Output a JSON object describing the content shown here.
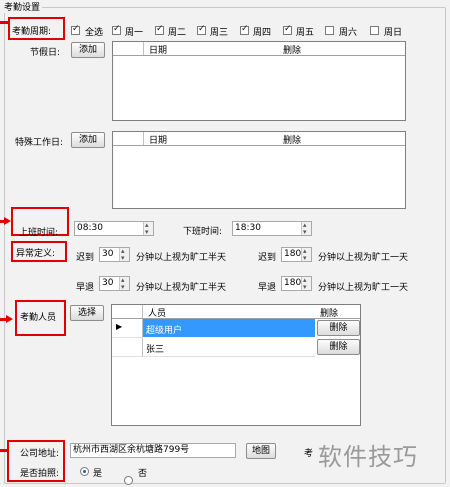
{
  "group_title": "考勤设置",
  "cycle": {
    "label": "考勤周期:",
    "days": [
      {
        "label": "全选",
        "checked": true
      },
      {
        "label": "周一",
        "checked": true
      },
      {
        "label": "周二",
        "checked": true
      },
      {
        "label": "周三",
        "checked": true
      },
      {
        "label": "周四",
        "checked": true
      },
      {
        "label": "周五",
        "checked": true
      },
      {
        "label": "周六",
        "checked": false
      },
      {
        "label": "周日",
        "checked": false
      }
    ]
  },
  "holiday": {
    "label": "节假日:",
    "add_button": "添加",
    "columns": [
      "日期",
      "删除"
    ]
  },
  "special_workday": {
    "label": "特殊工作日:",
    "add_button": "添加",
    "columns": [
      "日期",
      "删除"
    ]
  },
  "work_time": {
    "start_label": "上班时间:",
    "start_value": "08:30",
    "end_label": "下班时间:",
    "end_value": "18:30"
  },
  "anomaly": {
    "label": "异常定义:",
    "late_label": "迟到",
    "early_label": "早退",
    "half_value": "30",
    "full_value": "180",
    "half_text": "分钟以上视为旷工半天",
    "full_text": "分钟以上视为旷工一天"
  },
  "staff": {
    "label": "考勤人员",
    "select_button": "选择",
    "columns": [
      "人员",
      "删除"
    ],
    "rows": [
      {
        "name": "超级用户",
        "delete": "删除",
        "selected": true
      },
      {
        "name": "张三",
        "delete": "删除",
        "selected": false
      }
    ]
  },
  "address": {
    "label": "公司地址:",
    "value": "杭州市西湖区余杭塘路799号",
    "map_button": "地图",
    "truncated_label": "考"
  },
  "photo": {
    "label": "是否拍照:",
    "options": [
      {
        "label": "是",
        "selected": true
      },
      {
        "label": "否",
        "selected": false
      }
    ]
  },
  "watermark": "软件技巧",
  "colors": {
    "highlight": "#e00000",
    "selection": "#3399ff"
  }
}
